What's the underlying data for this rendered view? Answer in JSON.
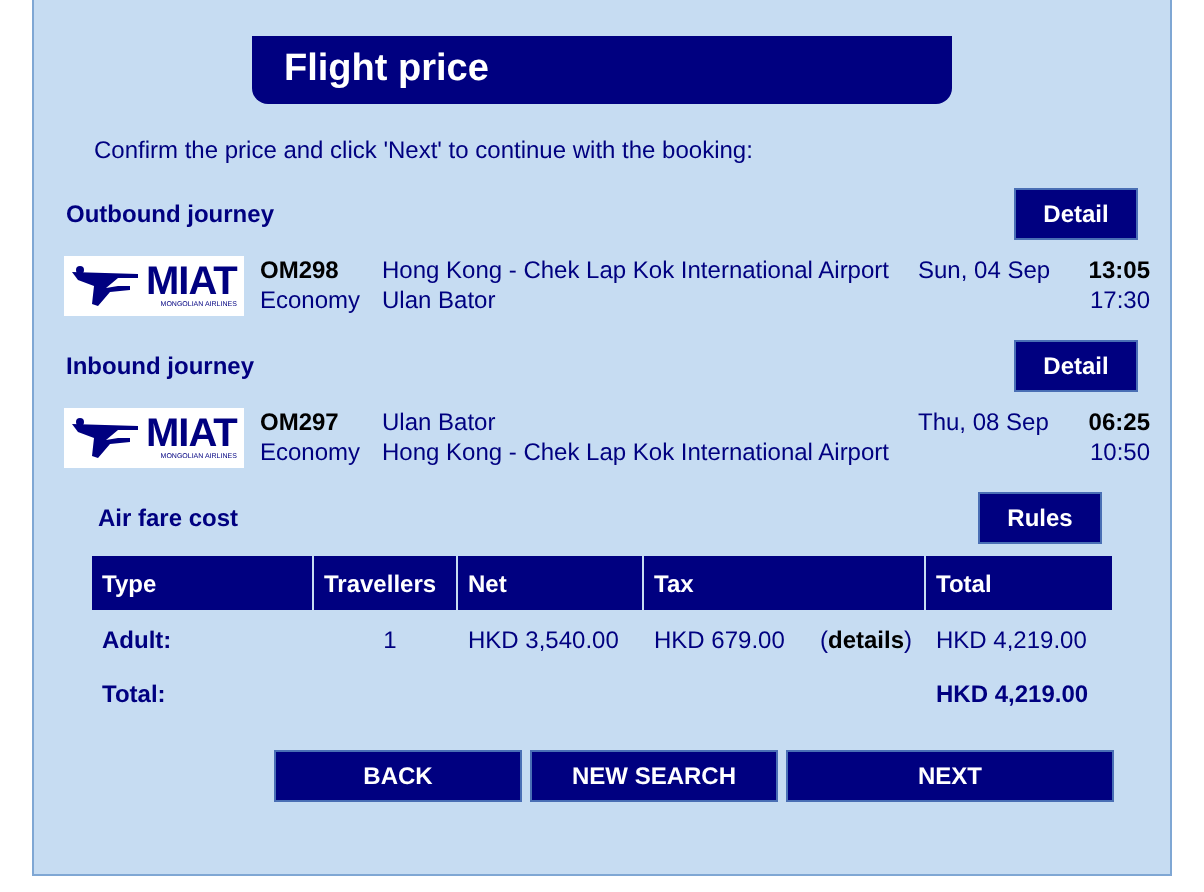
{
  "title": "Flight price",
  "intro": "Confirm the price and click 'Next' to continue with the booking:",
  "journeys": [
    {
      "heading": "Outbound journey",
      "detail_button": "Detail",
      "logo": {
        "name": "MIAT",
        "subtitle": "MONGOLIAN AIRLINES"
      },
      "flight": "OM298",
      "cabin": "Economy",
      "from": "Hong Kong - Chek Lap Kok International Airport",
      "to": "Ulan Bator",
      "date": "Sun, 04 Sep",
      "depart": "13:05",
      "arrive": "17:30"
    },
    {
      "heading": "Inbound journey",
      "detail_button": "Detail",
      "logo": {
        "name": "MIAT",
        "subtitle": "MONGOLIAN AIRLINES"
      },
      "flight": "OM297",
      "cabin": "Economy",
      "from": "Ulan Bator",
      "to": "Hong Kong - Chek Lap Kok International Airport",
      "date": "Thu, 08 Sep",
      "depart": "06:25",
      "arrive": "10:50"
    }
  ],
  "fare": {
    "heading": "Air fare cost",
    "rules_button": "Rules",
    "columns": [
      "Type",
      "Travellers",
      "Net",
      "Tax",
      "Total"
    ],
    "rows": [
      {
        "type": "Adult:",
        "travellers": "1",
        "net": "HKD 3,540.00",
        "tax": "HKD 679.00",
        "tax_link": "(**details**)",
        "total": "HKD 4,219.00"
      }
    ],
    "total_label": "Total:",
    "total_value": "HKD 4,219.00"
  },
  "buttons": [
    "BACK",
    "NEW SEARCH",
    "NEXT"
  ]
}
